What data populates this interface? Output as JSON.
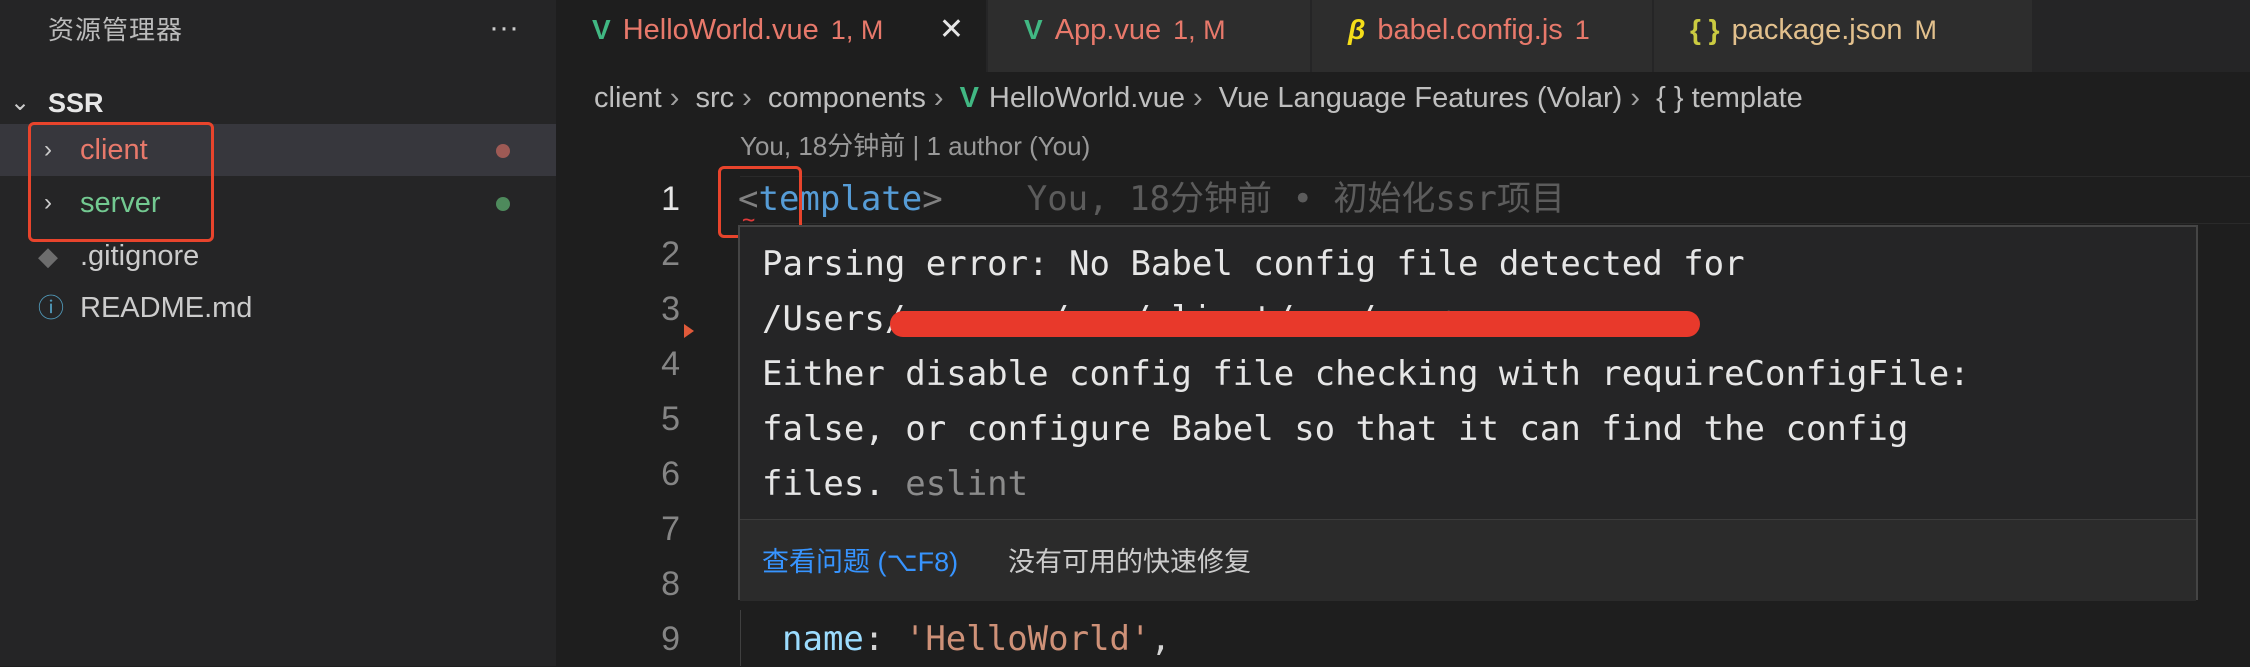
{
  "sidebar": {
    "title": "资源管理器",
    "more": "···",
    "root": "SSR",
    "items": [
      {
        "label": "client",
        "color": "#e8796b",
        "dot": "#9e5a55"
      },
      {
        "label": "server",
        "color": "#73c991",
        "dot": "#4e8a5c"
      },
      {
        "label": ".gitignore",
        "color": "#cccccc"
      },
      {
        "label": "README.md",
        "color": "#cccccc"
      }
    ]
  },
  "tabs": [
    {
      "icon": "V",
      "name": "HelloWorld.vue",
      "status": "1, M",
      "close": "✕",
      "color": "#e8796b",
      "icon_color": "#41b883"
    },
    {
      "icon": "V",
      "name": "App.vue",
      "status": "1, M",
      "color": "#e8796b",
      "icon_color": "#41b883"
    },
    {
      "icon": "β",
      "name": "babel.config.js",
      "status": "1",
      "color": "#e8796b",
      "icon_color": "#f5de19"
    },
    {
      "icon": "{ }",
      "name": "package.json",
      "status": "M",
      "color": "#e2c08d",
      "icon_color": "#cbcb41"
    }
  ],
  "breadcrumb": [
    "client",
    "src",
    "components",
    "HelloWorld.vue",
    "Vue Language Features (Volar)",
    "{ } template"
  ],
  "codelens": "You, 18分钟前 | 1 author (You)",
  "editor": {
    "line_numbers": [
      "1",
      "2",
      "3",
      "4",
      "5",
      "6",
      "7",
      "8",
      "9"
    ],
    "line1": {
      "open": "<",
      "tag": "template",
      "close": ">",
      "blame": "You, 18分钟前 • 初始化ssr项目"
    },
    "line9": {
      "key": "name",
      "colon": ": ",
      "value": "'HelloWorld'",
      "comma": ","
    }
  },
  "hover": {
    "lines": [
      "Parsing error: No Babel config file detected for",
      "/Users/  ...  /ssr/client/src/componen",
      "Either disable config file checking with requireConfigFile:",
      "false, or configure Babel so that it can find the config",
      "files. "
    ],
    "source": "eslint",
    "view_problem": "查看问题 (⌥F8)",
    "no_fix": "没有可用的快速修复"
  }
}
